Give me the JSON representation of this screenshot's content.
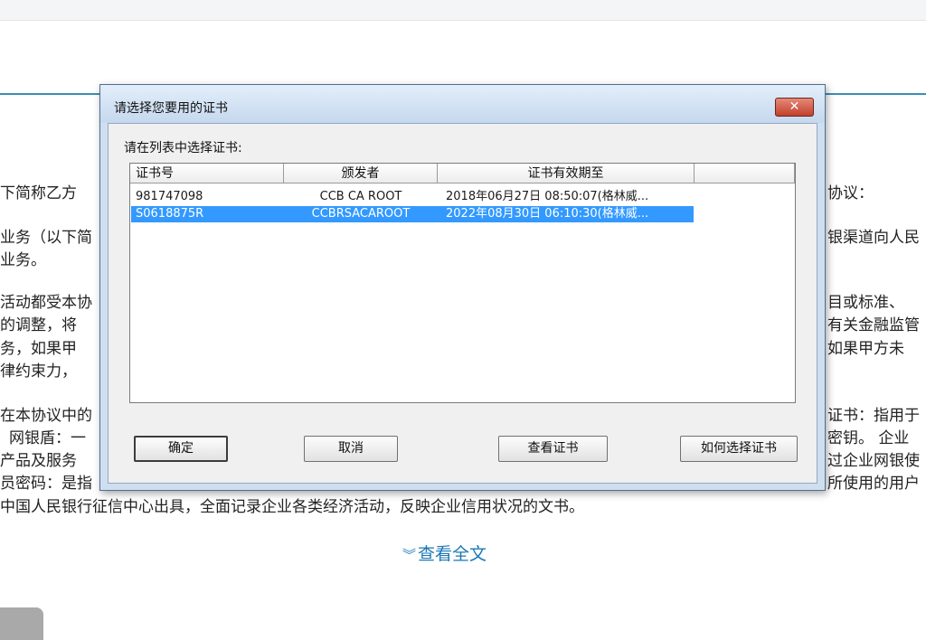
{
  "background": {
    "lines": [
      "下简称乙方",
      "协议：",
      "业务（以下简",
      "银渠道向人民",
      "业务。",
      "活动都受本协",
      "目或标准、",
      "的调整，将",
      "有关金融监管",
      "务，如果甲",
      "如果甲方未",
      "律约束力，",
      "在本协议中的",
      "证书：指用于",
      "网银盾：一",
      "密钥。 企业",
      "产品及服务",
      "过企业网银使",
      "员密码：是指",
      "所使用的用户",
      "中国人民银行征信中心出具，全面记录企业各类经济活动，反映企业信用状况的文书。"
    ],
    "view_all": "查看全文"
  },
  "dialog": {
    "title": "请选择您要用的证书",
    "close_label": "✕",
    "prompt": "请在列表中选择证书:",
    "columns": [
      "证书号",
      "颁发者",
      "证书有效期至",
      ""
    ],
    "rows": [
      {
        "number": "981747098",
        "issuer": "CCB CA ROOT",
        "expiry": "2018年06月27日 08:50:07(格林威..."
      },
      {
        "number": "S0618875R",
        "issuer": "CCBRSACAROOT",
        "expiry": "2022年08月30日 06:10:30(格林威..."
      }
    ],
    "buttons": {
      "ok": "确定",
      "cancel": "取消",
      "view": "查看证书",
      "help": "如何选择证书"
    }
  }
}
